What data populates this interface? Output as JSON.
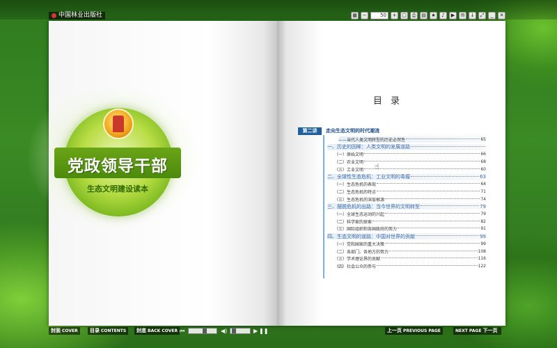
{
  "app": {
    "publisher": "中国林业出版社"
  },
  "toolbar": {
    "zoom_value": "50",
    "icons": [
      "grid-icon",
      "zoom-out-icon",
      "zoom-input",
      "zoom-in-icon",
      "fit-page-icon",
      "print-icon",
      "thumbnails-icon",
      "bookmark-icon",
      "sound-icon",
      "autoplay-icon",
      "share-icon",
      "download-icon",
      "fullscreen-icon",
      "minimize-icon",
      "close-icon"
    ]
  },
  "cover": {
    "title": "党政领导干部",
    "subtitle": "生态文明建设读本"
  },
  "toc": {
    "title": "目录",
    "chapter_badge": "第二讲",
    "chapter_title": "走向生态文明的时代潮流",
    "entries": [
      {
        "text": "——当代人类文明转型的历史必然性",
        "page": "65",
        "kind": "sub"
      },
      {
        "text": "一、历史的回眸：人类文明的发展道路",
        "page": "",
        "kind": "sec"
      },
      {
        "text": "（一）原始文明",
        "page": "66",
        "kind": "item"
      },
      {
        "text": "（二）农业文明",
        "page": "68",
        "kind": "item"
      },
      {
        "text": "（三）工业文明",
        "page": "60",
        "kind": "item"
      },
      {
        "text": "二、全球性生态危机：工业文明的毒瘤",
        "page": "63",
        "kind": "sec"
      },
      {
        "text": "（一）生态危机的表现",
        "page": "64",
        "kind": "item"
      },
      {
        "text": "（二）生态危机的特点",
        "page": "71",
        "kind": "item"
      },
      {
        "text": "（三）生态危机的深层根源",
        "page": "74",
        "kind": "item"
      },
      {
        "text": "三、摆脱危机的出路：当今世界的文明转型",
        "page": "79",
        "kind": "sec"
      },
      {
        "text": "（一）全球生态运动的兴起",
        "page": "79",
        "kind": "item"
      },
      {
        "text": "（二）科学家的探索",
        "page": "82",
        "kind": "item"
      },
      {
        "text": "（三）国际组织和各国政府的努力",
        "page": "91",
        "kind": "item"
      },
      {
        "text": "四、生态文明的道路：中国对世界的贡献",
        "page": "99",
        "kind": "sec"
      },
      {
        "text": "（一）党和国家的重大决策",
        "page": "99",
        "kind": "item"
      },
      {
        "text": "（二）各部门、各地方的努力",
        "page": "108",
        "kind": "item"
      },
      {
        "text": "（三）学术理论界的贡献",
        "page": "116",
        "kind": "item"
      },
      {
        "text": "（四）社会公众的参与",
        "page": "122",
        "kind": "item"
      }
    ]
  },
  "bottom": {
    "cover_cn": "封面",
    "cover_en": "COVER",
    "contents_cn": "目录",
    "contents_en": "CONTENTS",
    "back_cn": "封底",
    "back_en": "BACK COVER",
    "prev_cn": "上一页",
    "prev_en": "PREVIOUS PAGE",
    "next_en": "NEXT PAGE",
    "next_cn": "下一页"
  },
  "colors": {
    "accent": "#1f5f9a",
    "cover_green": "#6aa417"
  }
}
